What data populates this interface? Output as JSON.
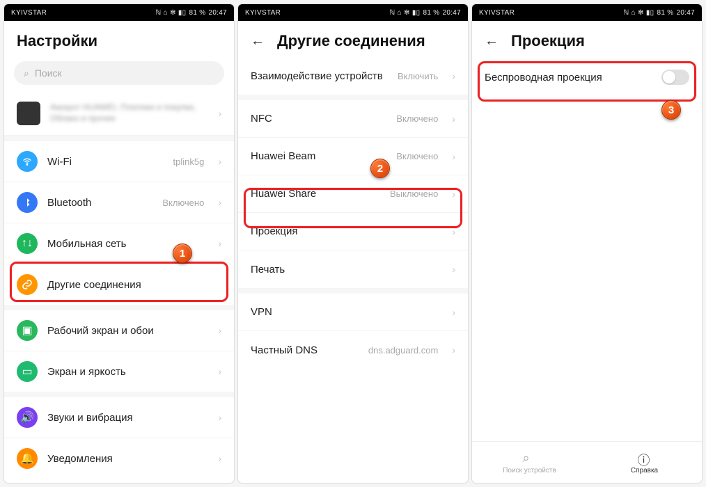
{
  "statusbar": {
    "carrier": "KYIVSTAR",
    "battery": "81 %",
    "time": "20:47",
    "icons": "ℕ ⌂ ✻ ▮▯"
  },
  "panel1": {
    "title": "Настройки",
    "search_placeholder": "Поиск",
    "account": {
      "name": " ",
      "sub": "Аккаунт HUAWEI, Платежи и покупки, Облако и прочее"
    },
    "items": [
      {
        "label": "Wi-Fi",
        "value": "tplink5g"
      },
      {
        "label": "Bluetooth",
        "value": "Включено"
      },
      {
        "label": "Мобильная сеть",
        "value": ""
      },
      {
        "label": "Другие соединения",
        "value": ""
      },
      {
        "label": "Рабочий экран и обои",
        "value": ""
      },
      {
        "label": "Экран и яркость",
        "value": ""
      },
      {
        "label": "Звуки и вибрация",
        "value": ""
      },
      {
        "label": "Уведомления",
        "value": ""
      }
    ],
    "step": "1"
  },
  "panel2": {
    "title": "Другие соединения",
    "items": [
      {
        "label": "Взаимодействие устройств",
        "value": "Включить"
      },
      {
        "label": "NFC",
        "value": "Включено"
      },
      {
        "label": "Huawei Beam",
        "value": "Включено"
      },
      {
        "label": "Huawei Share",
        "value": "Выключено"
      },
      {
        "label": "Проекция",
        "value": ""
      },
      {
        "label": "Печать",
        "value": ""
      },
      {
        "label": "VPN",
        "value": ""
      },
      {
        "label": "Частный DNS",
        "value": "dns.adguard.com"
      }
    ],
    "step": "2"
  },
  "panel3": {
    "title": "Проекция",
    "toggle_label": "Беспроводная проекция",
    "step": "3",
    "bottom": {
      "search": "Поиск устройств",
      "help": "Справка"
    }
  }
}
